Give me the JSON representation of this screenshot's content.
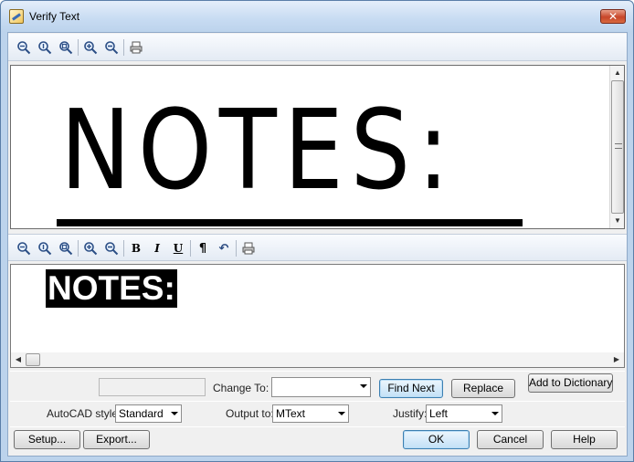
{
  "window": {
    "title": "Verify Text",
    "close_label": "✕"
  },
  "preview": {
    "image_text": "NOTES:"
  },
  "editor": {
    "text": "NOTES:"
  },
  "replace_row": {
    "change_to_label": "Change To:",
    "change_to_value": "",
    "find_next_label": "Find Next",
    "replace_label": "Replace",
    "add_dict_label": "Add to Dictionary"
  },
  "options_row": {
    "autocad_style_label": "AutoCAD style:",
    "autocad_style_value": "Standard",
    "output_label": "Output to:",
    "output_value": "MText",
    "justify_label": "Justify:",
    "justify_value": "Left"
  },
  "buttons": {
    "setup": "Setup...",
    "export": "Export...",
    "ok": "OK",
    "cancel": "Cancel",
    "help": "Help"
  },
  "format_toolbar": {
    "bold": "B",
    "italic": "I",
    "underline": "U",
    "paragraph": "¶",
    "undo": "↶"
  },
  "icons": [
    "zoom-out-icon",
    "zoom-actual-icon",
    "zoom-fit-icon",
    "zoom-in-icon",
    "zoom-minus-icon",
    "print-icon"
  ]
}
